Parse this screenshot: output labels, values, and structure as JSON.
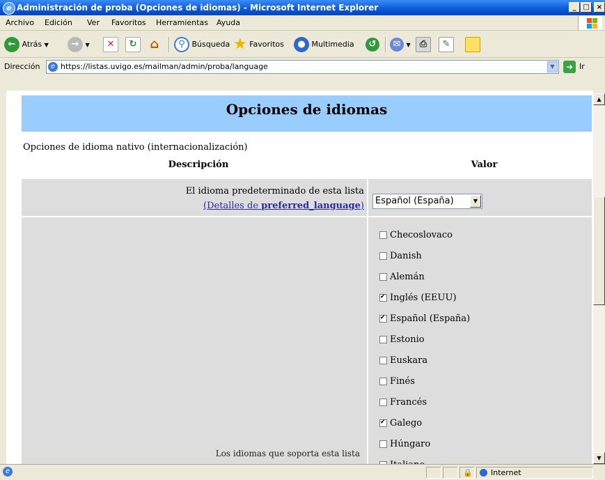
{
  "window": {
    "title": "Administración de proba (Opciones de idiomas) - Microsoft Internet Explorer",
    "min_label": "_",
    "max_label": "□",
    "close_label": "×"
  },
  "menu": [
    "Archivo",
    "Edición",
    "Ver",
    "Favoritos",
    "Herramientas",
    "Ayuda"
  ],
  "toolbar": {
    "back_label": "Atrás",
    "search_label": "Búsqueda",
    "favorites_label": "Favoritos",
    "media_label": "Multimedia"
  },
  "address": {
    "label": "Dirección",
    "url": "https://listas.uvigo.es/mailman/admin/proba/language",
    "go_label": "Ir"
  },
  "page": {
    "heading": "Opciones de idiomas",
    "intro": "Opciones de idioma nativo (internacionalización)",
    "col_description": "Descripción",
    "col_value": "Valor",
    "default_lang_desc": "El idioma predeterminado de esta lista",
    "details_prefix": "(Detalles de ",
    "details_link": "preferred_language",
    "details_suffix": ")",
    "default_lang_value": "Español (España)",
    "truncated_text": "Los idiomas que soporta esta lista"
  },
  "languages": [
    {
      "label": "Checoslovaco",
      "checked": false
    },
    {
      "label": "Danish",
      "checked": false
    },
    {
      "label": "Alemán",
      "checked": false
    },
    {
      "label": "Inglés (EEUU)",
      "checked": true
    },
    {
      "label": "Español (España)",
      "checked": true
    },
    {
      "label": "Estonio",
      "checked": false
    },
    {
      "label": "Euskara",
      "checked": false
    },
    {
      "label": "Finés",
      "checked": false
    },
    {
      "label": "Francés",
      "checked": false
    },
    {
      "label": "Galego",
      "checked": true
    },
    {
      "label": "Húngaro",
      "checked": false
    },
    {
      "label": "Italiano",
      "checked": false
    }
  ],
  "status": {
    "zone": "Internet"
  }
}
